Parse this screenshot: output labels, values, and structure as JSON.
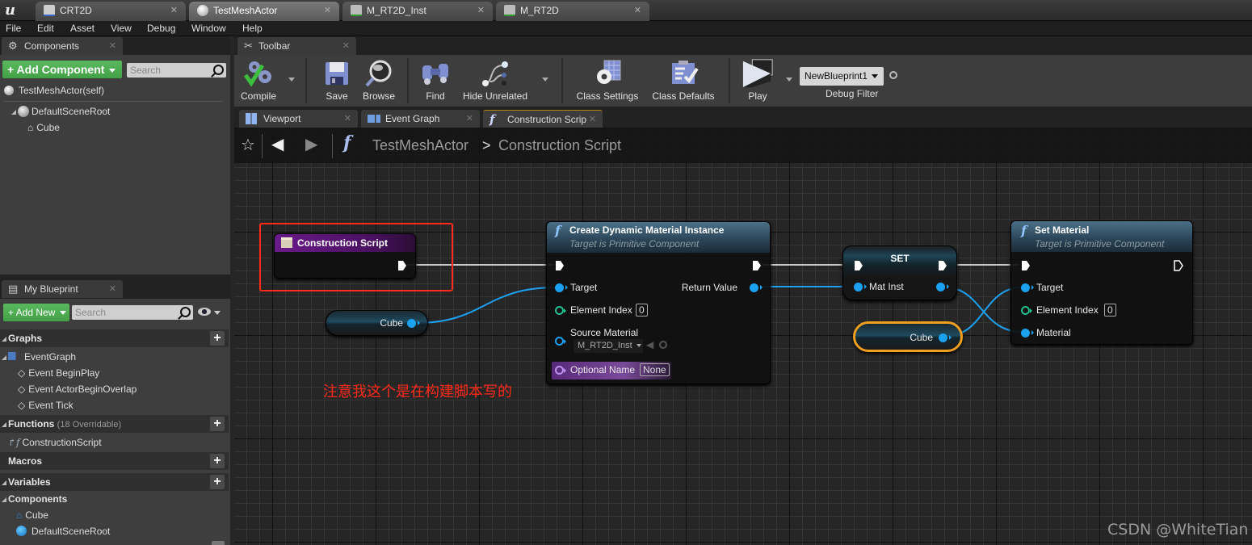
{
  "doc_tabs": [
    {
      "label": "CRT2D",
      "active": false
    },
    {
      "label": "TestMeshActor",
      "active": true
    },
    {
      "label": "M_RT2D_Inst",
      "active": false
    },
    {
      "label": "M_RT2D",
      "active": false
    }
  ],
  "menu": [
    "File",
    "Edit",
    "Asset",
    "View",
    "Debug",
    "Window",
    "Help"
  ],
  "components_panel": {
    "tab_label": "Components",
    "add_button": "+ Add Component",
    "search_placeholder": "Search",
    "self_label": "TestMeshActor(self)",
    "tree": [
      {
        "label": "DefaultSceneRoot",
        "level": 0
      },
      {
        "label": "Cube",
        "level": 1
      }
    ]
  },
  "toolbar": {
    "tab_label": "Toolbar",
    "buttons": {
      "compile": "Compile",
      "save": "Save",
      "browse": "Browse",
      "find": "Find",
      "hide_unrelated": "Hide Unrelated",
      "class_settings": "Class Settings",
      "class_defaults": "Class Defaults",
      "play": "Play"
    },
    "debug_filter": {
      "selected": "NewBlueprint1",
      "label": "Debug Filter"
    }
  },
  "editor_tabs": [
    {
      "label": "Viewport",
      "active": false
    },
    {
      "label": "Event Graph",
      "active": false
    },
    {
      "label": "Construction Scrip",
      "active": true
    }
  ],
  "breadcrumb": {
    "root": "TestMeshActor",
    "separator": ">",
    "current": "Construction Script"
  },
  "my_blueprint": {
    "tab_label": "My Blueprint",
    "add_button": "+ Add New",
    "search_placeholder": "Search",
    "sections": {
      "graphs": "Graphs",
      "functions": "Functions",
      "functions_sub": "(18 Overridable)",
      "macros": "Macros",
      "variables": "Variables",
      "components": "Components"
    },
    "graphs": {
      "event_graph": "EventGraph",
      "events": [
        "Event BeginPlay",
        "Event ActorBeginOverlap",
        "Event Tick"
      ]
    },
    "functions": [
      "ConstructionScript"
    ],
    "components": [
      "Cube",
      "DefaultSceneRoot"
    ]
  },
  "graph": {
    "nodes": {
      "construction_script": {
        "title": "Construction Script"
      },
      "cube_var_1": {
        "label": "Cube"
      },
      "create_dmi": {
        "title": "Create Dynamic Material Instance",
        "subtitle": "Target is Primitive Component",
        "pins": {
          "target": "Target",
          "element_index": "Element Index",
          "element_index_value": "0",
          "source_material": "Source Material",
          "source_material_value": "M_RT2D_Inst",
          "optional_name": "Optional Name",
          "optional_name_value": "None",
          "return_value": "Return Value"
        }
      },
      "set_node": {
        "title": "SET",
        "pin": "Mat Inst"
      },
      "cube_var_2": {
        "label": "Cube"
      },
      "set_material": {
        "title": "Set Material",
        "subtitle": "Target is Primitive Component",
        "pins": {
          "target": "Target",
          "element_index": "Element Index",
          "element_index_value": "0",
          "material": "Material"
        }
      }
    },
    "annotation": "注意我这个是在构建脚本写的",
    "watermark": "CSDN @WhiteTian"
  },
  "colors": {
    "accent_green": "#4caf50",
    "exec_wire": "#c8c8c8",
    "object_wire": "#1ca0f0",
    "highlight_box": "#ff2a1a",
    "selection": "#f0a020",
    "event_header": "#6a1b8a"
  }
}
